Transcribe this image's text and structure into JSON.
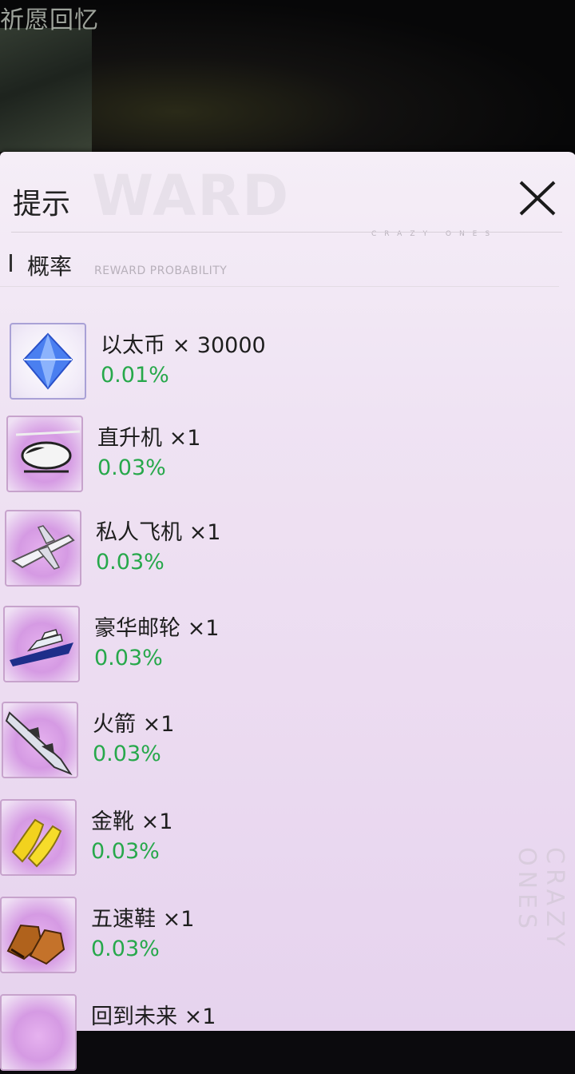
{
  "background": {
    "title": "祈愿回忆"
  },
  "dialog": {
    "title": "提示",
    "watermark": "WARD",
    "brand_watermark": "CRAZY ONES",
    "close_icon": "close-icon",
    "section": {
      "title": "概率",
      "subtitle": "REWARD PROBABILITY"
    }
  },
  "rewards": [
    {
      "name": "以太币 × 30000",
      "probability": "0.01%",
      "icon": "crystal-icon"
    },
    {
      "name": "直升机 ×1",
      "probability": "0.03%",
      "icon": "helicopter-icon"
    },
    {
      "name": "私人飞机 ×1",
      "probability": "0.03%",
      "icon": "airplane-icon"
    },
    {
      "name": "豪华邮轮 ×1",
      "probability": "0.03%",
      "icon": "yacht-icon"
    },
    {
      "name": "火箭 ×1",
      "probability": "0.03%",
      "icon": "rocket-icon"
    },
    {
      "name": "金靴 ×1",
      "probability": "0.03%",
      "icon": "golden-boots-icon"
    },
    {
      "name": "五速鞋 ×1",
      "probability": "0.03%",
      "icon": "sneakers-icon"
    },
    {
      "name": "回到未来 ×1",
      "probability": "",
      "icon": "item-icon"
    }
  ],
  "colors": {
    "probability": "#27a84b",
    "panel": "#efe3f3"
  }
}
